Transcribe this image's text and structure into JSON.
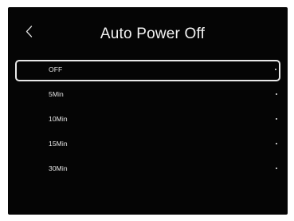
{
  "header": {
    "title": "Auto Power Off",
    "back_icon": "chevron-left-icon"
  },
  "options": [
    {
      "label": "OFF",
      "selected": true
    },
    {
      "label": "5Min",
      "selected": false
    },
    {
      "label": "10Min",
      "selected": false
    },
    {
      "label": "15Min",
      "selected": false
    },
    {
      "label": "30Min",
      "selected": false
    }
  ],
  "colors": {
    "background": "#050505",
    "text": "#e6e6e6",
    "selection_border": "#e8e8e8"
  }
}
